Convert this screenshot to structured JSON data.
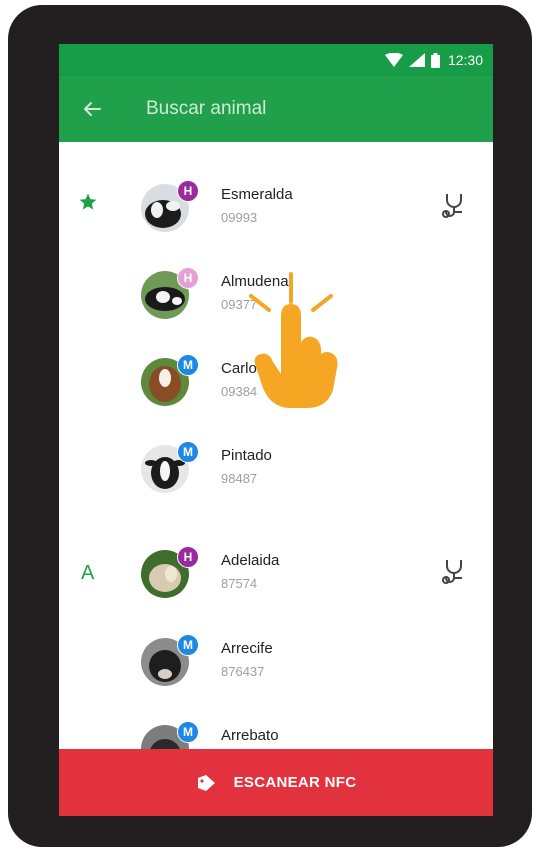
{
  "statusbar": {
    "time": "12:30",
    "icons": [
      "wifi-icon",
      "signal-icon",
      "battery-icon"
    ]
  },
  "appbar": {
    "title": "Buscar animal",
    "back_icon": "arrow-left-icon"
  },
  "sections": [
    {
      "marker": "★",
      "marker_icon": "star-icon"
    },
    {
      "marker": "A"
    }
  ],
  "items": [
    {
      "name": "Esmeralda",
      "code": "09993",
      "badge": "H",
      "badge_color": "#9a2b9f",
      "vet": true
    },
    {
      "name": "Almudena",
      "code": "09377",
      "badge": "H",
      "badge_color": "#e7a0d6",
      "vet": false
    },
    {
      "name": "Carlos",
      "code": "09384",
      "badge": "M",
      "badge_color": "#1e88e5",
      "vet": false
    },
    {
      "name": "Pintado",
      "code": "98487",
      "badge": "M",
      "badge_color": "#1e88e5",
      "vet": false
    },
    {
      "name": "Adelaida",
      "code": "87574",
      "badge": "H",
      "badge_color": "#9a2b9f",
      "vet": true
    },
    {
      "name": "Arrecife",
      "code": "876437",
      "badge": "M",
      "badge_color": "#1e88e5",
      "vet": false
    },
    {
      "name": "Arrebato",
      "code": "",
      "badge": "M",
      "badge_color": "#1e88e5",
      "vet": false
    }
  ],
  "fab": {
    "label": "ESCANEAR NFC",
    "icon": "nfc-tag-icon"
  },
  "colors": {
    "primary": "#21a04c",
    "primary_dark": "#179c47",
    "accent": "#e2323d",
    "pointer": "#f5a623"
  }
}
